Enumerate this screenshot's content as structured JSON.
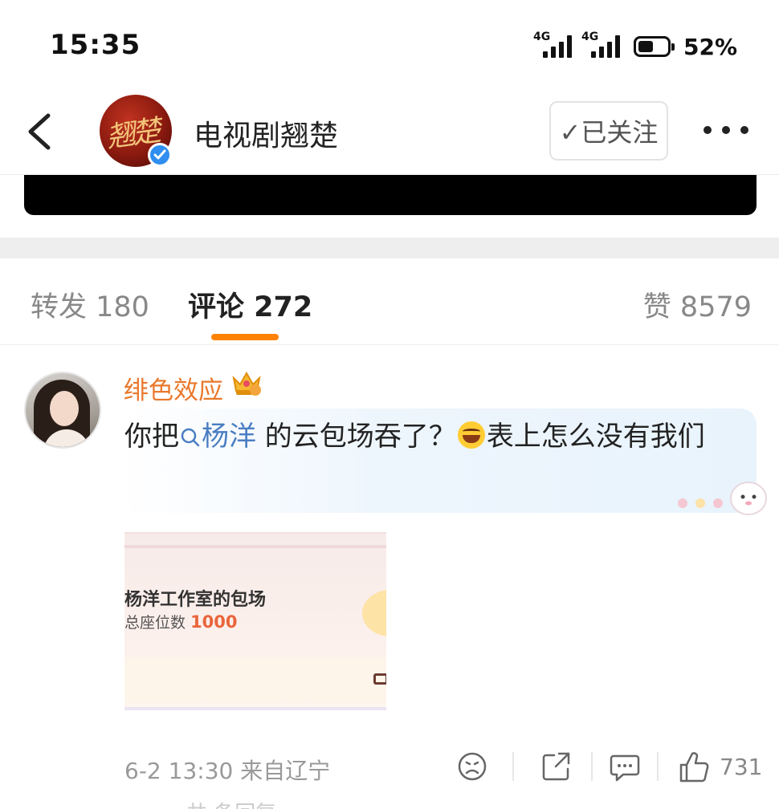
{
  "status_bar": {
    "time": "15:35",
    "network_1": "4G",
    "network_2": "4G",
    "battery_percent": "52%",
    "battery_level": 0.52
  },
  "header": {
    "back_icon": "chevron-left-icon",
    "account_name": "电视剧翘楚",
    "avatar_text": "翘楚",
    "follow_label": "✓已关注",
    "more_icon": "more-dots-icon"
  },
  "tabs": {
    "repost": "转发 180",
    "comment": "评论 272",
    "like": "赞 8579",
    "active": "comment"
  },
  "comment": {
    "username": "绯色效应",
    "badge_icon": "crown-badge-icon",
    "text_before": "你把",
    "topic": "杨洋",
    "text_after": " 的云包场吞了？",
    "text_end": "表上怎么没有我们",
    "image": {
      "title": "杨洋工作室的包场",
      "seat_label": "总座位数",
      "seat_count": "1000"
    },
    "time": "6-2 13:30",
    "location": "来自辽宁",
    "like_count": "731",
    "next_preview": "共 条回复"
  },
  "colors": {
    "accent": "#ff8200",
    "username": "#e9782b",
    "topic": "#4a7ec2",
    "verified": "#2f8ef0"
  }
}
